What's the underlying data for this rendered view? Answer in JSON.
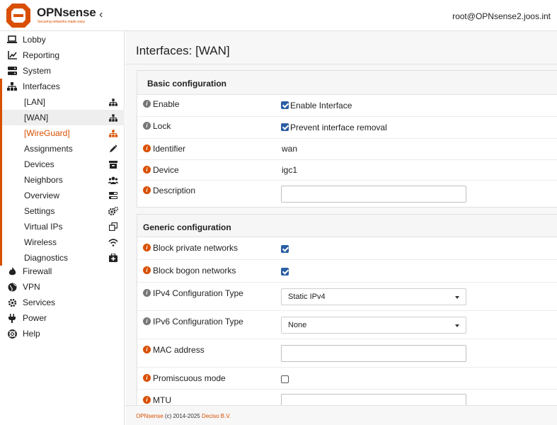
{
  "header": {
    "brand_prefix": "OPN",
    "brand_suffix": "sense",
    "tagline": "Securing networks made easy",
    "user": "root@OPNsense2.joos.int"
  },
  "sidebar": {
    "items": [
      {
        "label": "Lobby",
        "icon": "laptop-icon"
      },
      {
        "label": "Reporting",
        "icon": "chart-icon"
      },
      {
        "label": "System",
        "icon": "server-icon"
      },
      {
        "label": "Interfaces",
        "icon": "sitemap-icon"
      },
      {
        "label": "Firewall",
        "icon": "fire-icon"
      },
      {
        "label": "VPN",
        "icon": "globe-icon"
      },
      {
        "label": "Services",
        "icon": "cog-icon"
      },
      {
        "label": "Power",
        "icon": "plug-icon"
      },
      {
        "label": "Help",
        "icon": "life-ring-icon"
      }
    ],
    "interfaces_sub": [
      {
        "label": "[LAN]",
        "icon": "sitemap-icon"
      },
      {
        "label": "[WAN]",
        "icon": "sitemap-icon"
      },
      {
        "label": "[WireGuard]",
        "icon": "sitemap-icon"
      },
      {
        "label": "Assignments",
        "icon": "pencil-icon"
      },
      {
        "label": "Devices",
        "icon": "archive-icon"
      },
      {
        "label": "Neighbors",
        "icon": "users-icon"
      },
      {
        "label": "Overview",
        "icon": "tasks-icon"
      },
      {
        "label": "Settings",
        "icon": "cogs-icon"
      },
      {
        "label": "Virtual IPs",
        "icon": "clone-icon"
      },
      {
        "label": "Wireless",
        "icon": "wifi-icon"
      },
      {
        "label": "Diagnostics",
        "icon": "medkit-icon"
      }
    ]
  },
  "main": {
    "title": "Interfaces: [WAN]",
    "basic": {
      "header": "Basic configuration",
      "enable": {
        "label": "Enable",
        "checkbox_label": "Enable Interface",
        "checked": true
      },
      "lock": {
        "label": "Lock",
        "checkbox_label": "Prevent interface removal",
        "checked": true
      },
      "identifier": {
        "label": "Identifier",
        "value": "wan"
      },
      "device": {
        "label": "Device",
        "value": "igc1"
      },
      "description": {
        "label": "Description",
        "value": ""
      }
    },
    "generic": {
      "header": "Generic configuration",
      "block_private": {
        "label": "Block private networks",
        "checked": true
      },
      "block_bogon": {
        "label": "Block bogon networks",
        "checked": true
      },
      "ipv4_type": {
        "label": "IPv4 Configuration Type",
        "value": "Static IPv4"
      },
      "ipv6_type": {
        "label": "IPv6 Configuration Type",
        "value": "None"
      },
      "mac": {
        "label": "MAC address",
        "value": ""
      },
      "promisc": {
        "label": "Promiscuous mode",
        "checked": false
      },
      "mtu": {
        "label": "MTU",
        "value": ""
      }
    }
  },
  "footer": {
    "brand": "OPNsense",
    "copyright": " (c) 2014-2025 ",
    "company": "Deciso B.V."
  },
  "colors": {
    "accent": "#d94f00",
    "checkbox": "#2b5fa4"
  }
}
